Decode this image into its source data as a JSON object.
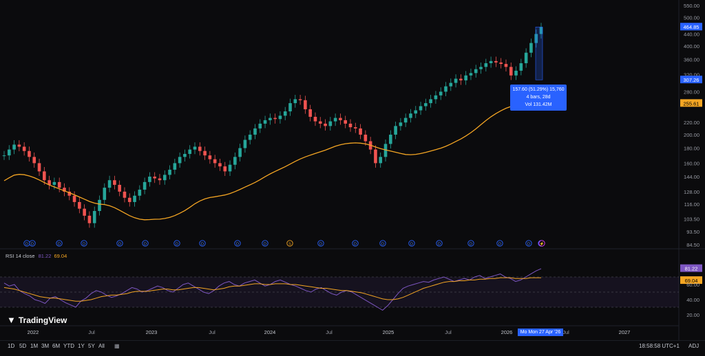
{
  "chart_data": {
    "type": "candlestick",
    "price_axis": {
      "ticks": [
        "550.00",
        "500.00",
        "464.85",
        "440.00",
        "400.00",
        "360.00",
        "320.00",
        "307.26",
        "280.00",
        "255.61",
        "220.00",
        "200.00",
        "180.00",
        "160.00",
        "144.00",
        "128.00",
        "116.00",
        "103.50",
        "93.50",
        "84.50"
      ]
    },
    "time_axis": {
      "ticks": [
        "2022",
        "Jul",
        "2023",
        "Jul",
        "2024",
        "Jul",
        "2025",
        "Jul",
        "2026",
        "Jul",
        "2027"
      ]
    },
    "last_price": "464.85",
    "cursor_price": "307.26",
    "ma_price": "255.61",
    "ma_color": "#f5a623",
    "up_color": "#26a69a",
    "down_color": "#ef5350",
    "closes": [
      170,
      178,
      185,
      182,
      176,
      168,
      160,
      150,
      140,
      135,
      138,
      132,
      128,
      124,
      118,
      112,
      106,
      100,
      110,
      120,
      132,
      140,
      135,
      128,
      122,
      118,
      124,
      130,
      138,
      144,
      142,
      140,
      146,
      152,
      160,
      168,
      172,
      178,
      182,
      176,
      170,
      165,
      160,
      156,
      150,
      158,
      168,
      180,
      192,
      200,
      210,
      218,
      224,
      228,
      226,
      232,
      240,
      256,
      264,
      262,
      244,
      230,
      222,
      218,
      214,
      222,
      228,
      224,
      218,
      212,
      210,
      200,
      190,
      178,
      160,
      168,
      186,
      200,
      214,
      220,
      228,
      236,
      242,
      250,
      256,
      264,
      272,
      280,
      292,
      300,
      310,
      306,
      318,
      324,
      334,
      340,
      350,
      356,
      352,
      348,
      340,
      318,
      330,
      350,
      380,
      410,
      440,
      464
    ]
  },
  "rsi": {
    "label": "RSI 14 close",
    "value1": "81.22",
    "value2": "69.04",
    "axis": [
      "81.22",
      "69.04",
      "60.00",
      "40.00",
      "20.00"
    ],
    "values": [
      62,
      58,
      60,
      52,
      48,
      45,
      40,
      38,
      35,
      42,
      44,
      40,
      36,
      33,
      30,
      38,
      42,
      48,
      52,
      50,
      46,
      43,
      45,
      48,
      52,
      56,
      54,
      50,
      52,
      55,
      58,
      56,
      52,
      50,
      55,
      60,
      62,
      58,
      54,
      50,
      48,
      52,
      58,
      62,
      64,
      60,
      58,
      62,
      64,
      66,
      62,
      58,
      60,
      64,
      66,
      63,
      60,
      58,
      55,
      52,
      50,
      54,
      56,
      52,
      48,
      46,
      50,
      52,
      50,
      46,
      42,
      38,
      34,
      30,
      26,
      32,
      40,
      48,
      55,
      58,
      60,
      62,
      64,
      63,
      66,
      68,
      70,
      67,
      64,
      66,
      68,
      66,
      70,
      72,
      68,
      70,
      72,
      74,
      70,
      68,
      64,
      66,
      70,
      74,
      78,
      81
    ],
    "signal": [
      56,
      55,
      54,
      52,
      50,
      48,
      46,
      44,
      43,
      42,
      42,
      41,
      40,
      39,
      38,
      38,
      39,
      40,
      42,
      44,
      45,
      46,
      46,
      47,
      48,
      50,
      51,
      51,
      51,
      52,
      53,
      54,
      54,
      53,
      53,
      54,
      55,
      56,
      56,
      55,
      54,
      53,
      54,
      55,
      57,
      58,
      58,
      59,
      60,
      61,
      61,
      60,
      60,
      61,
      61,
      61,
      60,
      60,
      59,
      58,
      57,
      56,
      55,
      55,
      54,
      53,
      52,
      52,
      51,
      50,
      49,
      47,
      45,
      43,
      41,
      40,
      40,
      41,
      43,
      46,
      49,
      52,
      55,
      57,
      59,
      61,
      63,
      64,
      64,
      65,
      65,
      66,
      66,
      67,
      67,
      68,
      68,
      69,
      69,
      69,
      68,
      68,
      68,
      69,
      69,
      69
    ]
  },
  "events": [
    "D",
    "D",
    "D",
    "D",
    "D",
    "D",
    "D",
    "D",
    "D",
    "D",
    "S",
    "D",
    "D",
    "D",
    "D",
    "D",
    "D",
    "D",
    "D",
    "D",
    "⚡"
  ],
  "measure": {
    "line1": "157.60 (51.29%) 15,760",
    "line2": "4 bars, 28d",
    "line3": "Vol 131.42M"
  },
  "date_tag": "Mo  Mon 27 Apr '26",
  "logo_text": "TradingView",
  "ranges": [
    "1D",
    "5D",
    "1M",
    "3M",
    "6M",
    "YTD",
    "1Y",
    "5Y",
    "All"
  ],
  "clock": "18:58:58 UTC+1",
  "adj_label": "ADJ"
}
